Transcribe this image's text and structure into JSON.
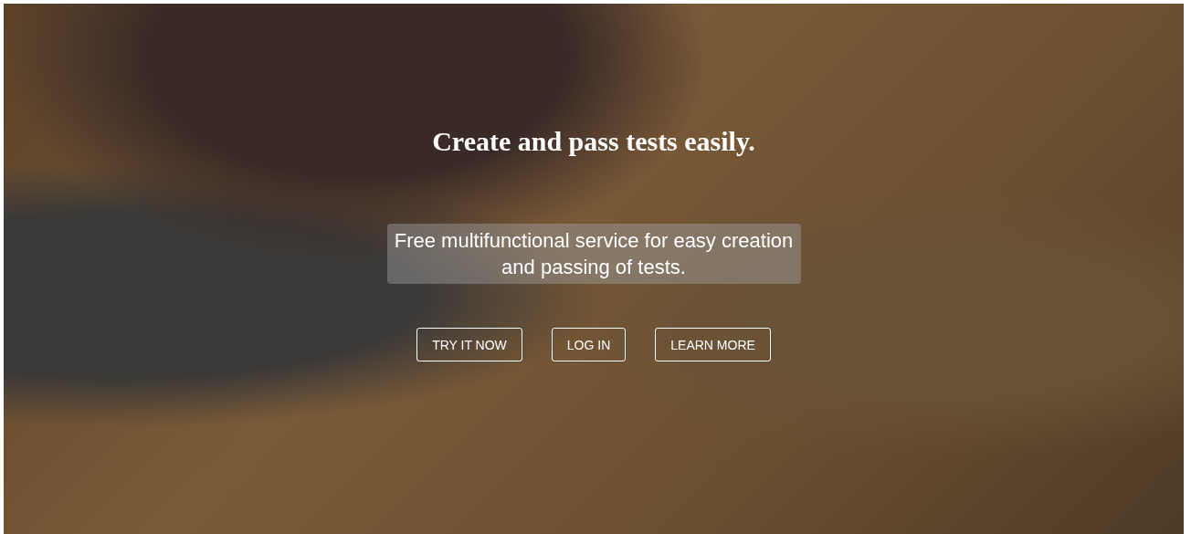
{
  "hero": {
    "title": "Create and pass tests easily.",
    "subtitle": "Free multifunctional service for easy creation and passing of tests.",
    "buttons": [
      {
        "label": "TRY IT NOW"
      },
      {
        "label": "LOG IN"
      },
      {
        "label": "LEARN MORE"
      }
    ]
  }
}
